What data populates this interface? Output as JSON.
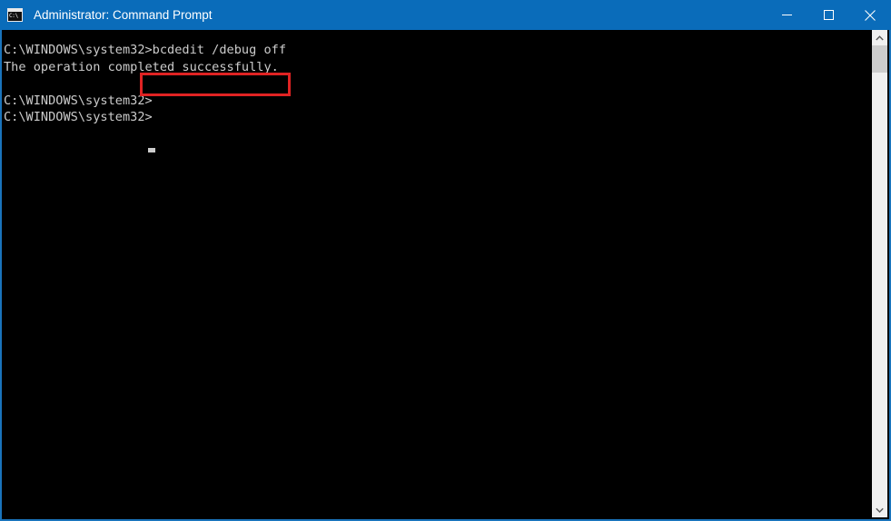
{
  "window": {
    "title": "Administrator: Command Prompt",
    "icon": "command-prompt-icon",
    "icon_glyph": "C:\\",
    "titlebar_color": "#0a6cba",
    "border_color": "#1a74bb"
  },
  "controls": {
    "minimize_label": "Minimize",
    "maximize_label": "Maximize",
    "close_label": "Close"
  },
  "terminal": {
    "background": "#000000",
    "foreground": "#cccccc",
    "prompt": "C:\\WINDOWS\\system32>",
    "command": "bcdedit /debug off",
    "output": "The operation completed successfully.",
    "content": "C:\\WINDOWS\\system32>bcdedit /debug off\nThe operation completed successfully.\n\nC:\\WINDOWS\\system32>\nC:\\WINDOWS\\system32>",
    "lines": [
      "C:\\WINDOWS\\system32>bcdedit /debug off",
      "The operation completed successfully.",
      "",
      "C:\\WINDOWS\\system32>",
      "C:\\WINDOWS\\system32>"
    ]
  },
  "annotation": {
    "highlight_color": "#e02323",
    "highlight_target": "bcdedit /debug off"
  },
  "scrollbar": {
    "up_arrow": "chevron-up-icon",
    "down_arrow": "chevron-down-icon",
    "track_color": "#f0f0f0",
    "thumb_color": "#cdcdcd"
  }
}
